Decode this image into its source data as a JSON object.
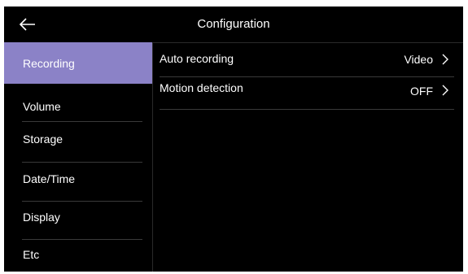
{
  "header": {
    "title": "Configuration",
    "back_icon": "arrow-left-icon"
  },
  "sidebar": {
    "items": [
      {
        "label": "Recording",
        "active": true
      },
      {
        "label": "Volume",
        "active": false
      },
      {
        "label": "Storage",
        "active": false
      },
      {
        "label": "Date/Time",
        "active": false
      },
      {
        "label": "Display",
        "active": false
      },
      {
        "label": "Etc",
        "active": false
      }
    ],
    "active_color": "#8b82c7"
  },
  "settings": {
    "rows": [
      {
        "label": "Auto recording",
        "value": "Video",
        "icon": "chevron-right-icon"
      },
      {
        "label": "Motion detection",
        "value": "OFF",
        "icon": "chevron-right-icon"
      }
    ]
  }
}
